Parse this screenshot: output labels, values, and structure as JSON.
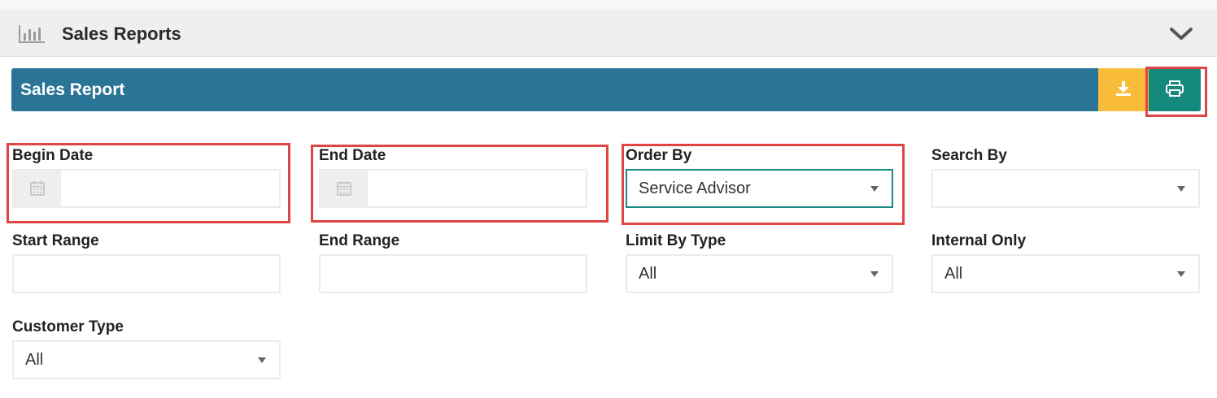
{
  "header": {
    "title": "Sales Reports",
    "chart_icon": "bar-chart-icon",
    "collapse_icon": "chevron-down-icon"
  },
  "report_bar": {
    "title": "Sales Report",
    "download_icon": "download-icon",
    "print_icon": "print-icon",
    "download_color": "#f9bc3a",
    "print_color": "#16897f",
    "bar_color": "#2a7496"
  },
  "filters": {
    "begin_date": {
      "label": "Begin Date",
      "value": ""
    },
    "end_date": {
      "label": "End Date",
      "value": ""
    },
    "order_by": {
      "label": "Order By",
      "value": "Service Advisor"
    },
    "search_by": {
      "label": "Search By",
      "value": ""
    },
    "start_range": {
      "label": "Start Range",
      "value": ""
    },
    "end_range": {
      "label": "End Range",
      "value": ""
    },
    "limit_by_type": {
      "label": "Limit By Type",
      "value": "All"
    },
    "internal_only": {
      "label": "Internal Only",
      "value": "All"
    },
    "customer_type": {
      "label": "Customer Type",
      "value": "All"
    }
  },
  "colors": {
    "highlight": "#e04545",
    "focus": "#1a8a86"
  }
}
